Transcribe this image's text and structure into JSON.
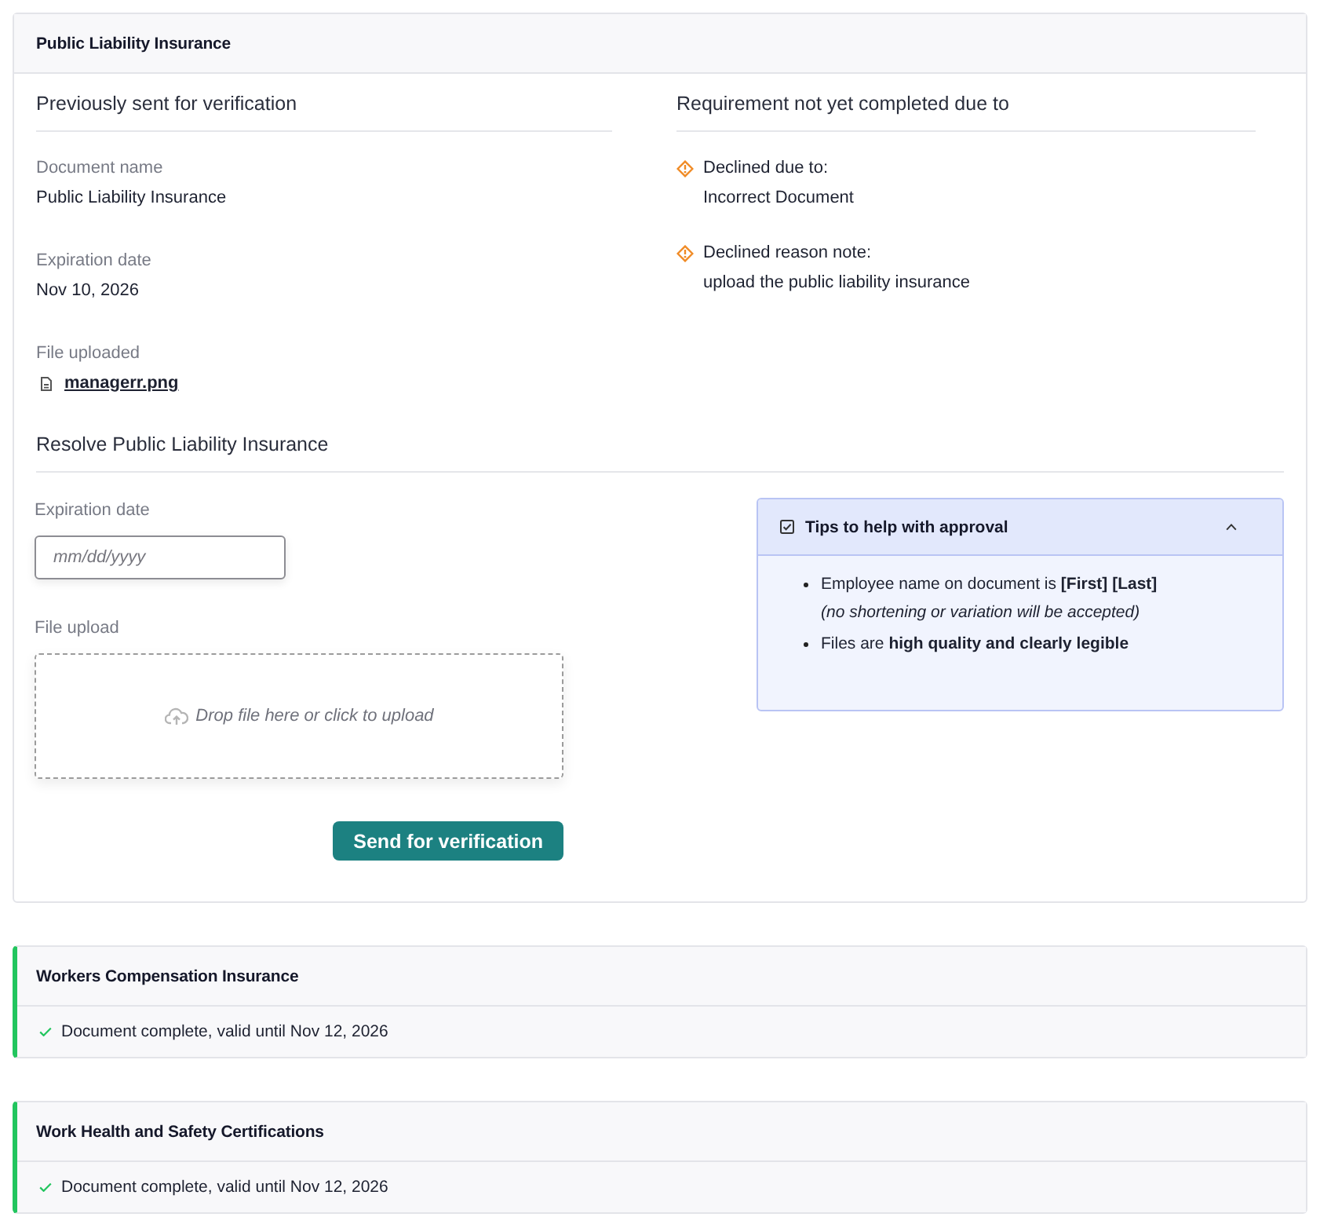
{
  "requirement": {
    "title": "Public Liability Insurance",
    "complete": false,
    "previous": {
      "heading": "Previously sent for verification",
      "fields": [
        {
          "kind": "text",
          "label": "Document name",
          "value": "Public Liability Insurance"
        },
        {
          "kind": "text",
          "label": "Expiration date",
          "value": "Nov 10, 2026"
        },
        {
          "kind": "file",
          "label": "File uploaded",
          "value": "managerr.png"
        }
      ]
    },
    "issues": {
      "heading": "Requirement not yet completed due to",
      "items": [
        {
          "label": "Declined due to:",
          "value": "Incorrect Document"
        },
        {
          "label": "Declined reason note:",
          "value": "upload the public liability insurance"
        }
      ]
    },
    "resolve": {
      "heading": "Resolve Public Liability Insurance",
      "date_field": {
        "label": "Expiration date",
        "placeholder": "mm/dd/yyyy"
      },
      "upload": {
        "label": "File upload",
        "prompt": "Drop file here or click to upload"
      },
      "submit": "Send for verification",
      "tips": {
        "title": "Tips to help with approval",
        "expanded": true,
        "items": [
          {
            "text": "Employee name on document is **[First] [Last]**",
            "note": "(no shortening or variation will be accepted)"
          },
          {
            "text": "Files are **high quality and clearly legible**"
          }
        ]
      }
    }
  },
  "completed": [
    {
      "title": "Workers Compensation Insurance",
      "complete": true,
      "status": "Document complete, valid until Nov 12, 2026"
    },
    {
      "title": "Work Health and Safety Certifications",
      "complete": true,
      "status": "Document complete, valid until Nov 12, 2026"
    }
  ]
}
